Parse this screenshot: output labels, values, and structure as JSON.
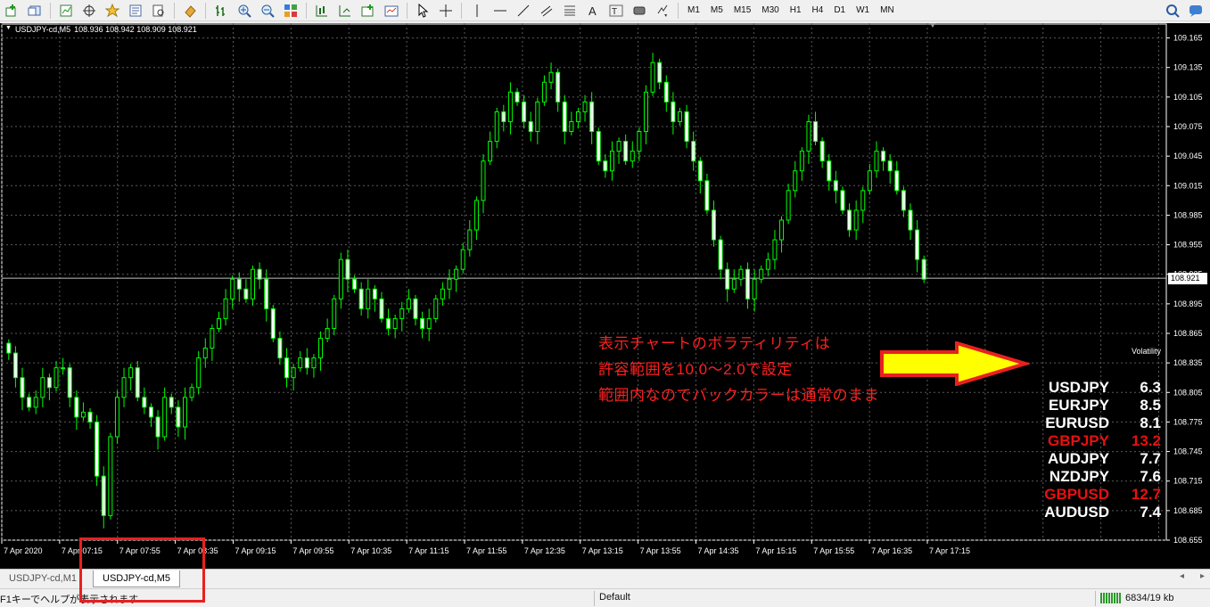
{
  "toolbar": {
    "timeframes": [
      "M1",
      "M5",
      "M15",
      "M30",
      "H1",
      "H4",
      "D1",
      "W1",
      "MN"
    ]
  },
  "chart": {
    "header_symbol": "USDJPY-cd,M5",
    "header_ohlc": "108.936 108.942 108.909 108.921",
    "current_price": "108.921",
    "price_labels": [
      "109.165",
      "109.135",
      "109.105",
      "109.075",
      "109.045",
      "109.015",
      "108.985",
      "108.955",
      "108.925",
      "108.895",
      "108.865",
      "108.835",
      "108.805",
      "108.775",
      "108.745",
      "108.715",
      "108.685",
      "108.655"
    ],
    "time_labels": [
      "7 Apr 2020",
      "7 Apr 07:15",
      "7 Apr 07:55",
      "7 Apr 08:35",
      "7 Apr 09:15",
      "7 Apr 09:55",
      "7 Apr 10:35",
      "7 Apr 11:15",
      "7 Apr 11:55",
      "7 Apr 12:35",
      "7 Apr 13:15",
      "7 Apr 13:55",
      "7 Apr 14:35",
      "7 Apr 15:15",
      "7 Apr 15:55",
      "7 Apr 16:35",
      "7 Apr 17:15"
    ],
    "colors": {
      "background": "#000000",
      "grid": "#5a5a5a",
      "bull_body": "#000000",
      "bear_body": "#ffffff",
      "candle_outline": "#00ff00"
    }
  },
  "annotation": {
    "line1": "表示チャートのボラティリティは",
    "line2": "許容範囲を10.0〜2.0で設定",
    "line3": "範囲内なのでバックカラーは通常のまま"
  },
  "volatility": {
    "title": "Volatility",
    "rows": [
      {
        "symbol": "USDJPY",
        "value": "6.3",
        "color": "#ffffff"
      },
      {
        "symbol": "EURJPY",
        "value": "8.5",
        "color": "#ffffff"
      },
      {
        "symbol": "EURUSD",
        "value": "8.1",
        "color": "#ffffff"
      },
      {
        "symbol": "GBPJPY",
        "value": "13.2",
        "color": "#e81010"
      },
      {
        "symbol": "AUDJPY",
        "value": "7.7",
        "color": "#ffffff"
      },
      {
        "symbol": "NZDJPY",
        "value": "7.6",
        "color": "#ffffff"
      },
      {
        "symbol": "GBPUSD",
        "value": "12.7",
        "color": "#e81010"
      },
      {
        "symbol": "AUDUSD",
        "value": "7.4",
        "color": "#ffffff"
      }
    ]
  },
  "tabs": {
    "tab1": "USDJPY-cd,M1",
    "tab2": "USDJPY-cd,M5"
  },
  "statusbar": {
    "help": "F1キーでヘルプが表示されます",
    "profile": "Default",
    "traffic": "6834/19 kb"
  },
  "chart_data": {
    "type": "candlestick",
    "ylim": [
      108.655,
      109.18
    ],
    "close": [
      108.845,
      108.82,
      108.8,
      108.79,
      108.8,
      108.82,
      108.81,
      108.83,
      108.83,
      108.8,
      108.78,
      108.785,
      108.775,
      108.72,
      108.68,
      108.76,
      108.8,
      108.82,
      108.83,
      108.8,
      108.79,
      108.78,
      108.76,
      108.8,
      108.79,
      108.77,
      108.8,
      108.81,
      108.84,
      108.85,
      108.87,
      108.88,
      108.9,
      108.92,
      108.91,
      108.9,
      108.93,
      108.92,
      108.89,
      108.86,
      108.84,
      108.82,
      108.83,
      108.84,
      108.83,
      108.84,
      108.86,
      108.87,
      108.9,
      108.94,
      108.92,
      108.91,
      108.89,
      108.91,
      108.9,
      108.88,
      108.87,
      108.88,
      108.89,
      108.9,
      108.88,
      108.87,
      108.88,
      108.9,
      108.91,
      108.92,
      108.93,
      108.95,
      108.97,
      109.0,
      109.04,
      109.06,
      109.09,
      109.08,
      109.11,
      109.1,
      109.08,
      109.07,
      109.1,
      109.12,
      109.13,
      109.1,
      109.07,
      109.08,
      109.09,
      109.1,
      109.07,
      109.04,
      109.03,
      109.05,
      109.06,
      109.04,
      109.05,
      109.07,
      109.11,
      109.14,
      109.12,
      109.1,
      109.08,
      109.09,
      109.06,
      109.04,
      109.02,
      108.99,
      108.96,
      108.93,
      108.91,
      108.92,
      108.93,
      108.9,
      108.92,
      108.93,
      108.94,
      108.96,
      108.98,
      109.01,
      109.03,
      109.05,
      109.08,
      109.06,
      109.04,
      109.02,
      109.01,
      108.99,
      108.97,
      108.99,
      109.01,
      109.03,
      109.05,
      109.04,
      109.03,
      109.01,
      108.99,
      108.97,
      108.94,
      108.92
    ]
  }
}
